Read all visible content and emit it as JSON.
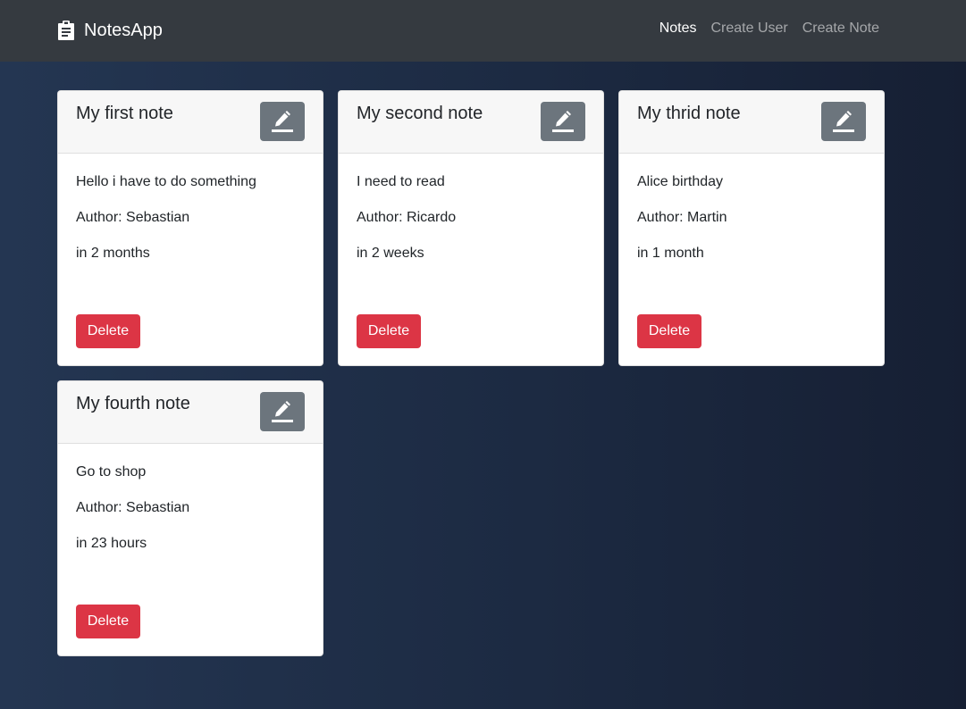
{
  "navbar": {
    "brand": "NotesApp",
    "brand_icon": "clipboard-icon",
    "links": [
      {
        "label": "Notes",
        "active": true
      },
      {
        "label": "Create User",
        "active": false
      },
      {
        "label": "Create Note",
        "active": false
      }
    ]
  },
  "notes": [
    {
      "title": "My first note",
      "content": "Hello i have to do something",
      "author": "Author: Sebastian",
      "time": "in 2 months",
      "delete_label": "Delete",
      "edit_icon": "edit-icon"
    },
    {
      "title": "My second note",
      "content": "I need to read",
      "author": "Author: Ricardo",
      "time": "in 2 weeks",
      "delete_label": "Delete",
      "edit_icon": "edit-icon"
    },
    {
      "title": "My thrid note",
      "content": "Alice birthday",
      "author": "Author: Martin",
      "time": "in 1 month",
      "delete_label": "Delete",
      "edit_icon": "edit-icon"
    },
    {
      "title": "My fourth note",
      "content": "Go to shop",
      "author": "Author: Sebastian",
      "time": "in 23 hours",
      "delete_label": "Delete",
      "edit_icon": "edit-icon"
    }
  ],
  "colors": {
    "navbar": "#353a40",
    "edit_button": "#6c757d",
    "delete_button": "#dc3545",
    "card_header": "#f7f7f7"
  }
}
